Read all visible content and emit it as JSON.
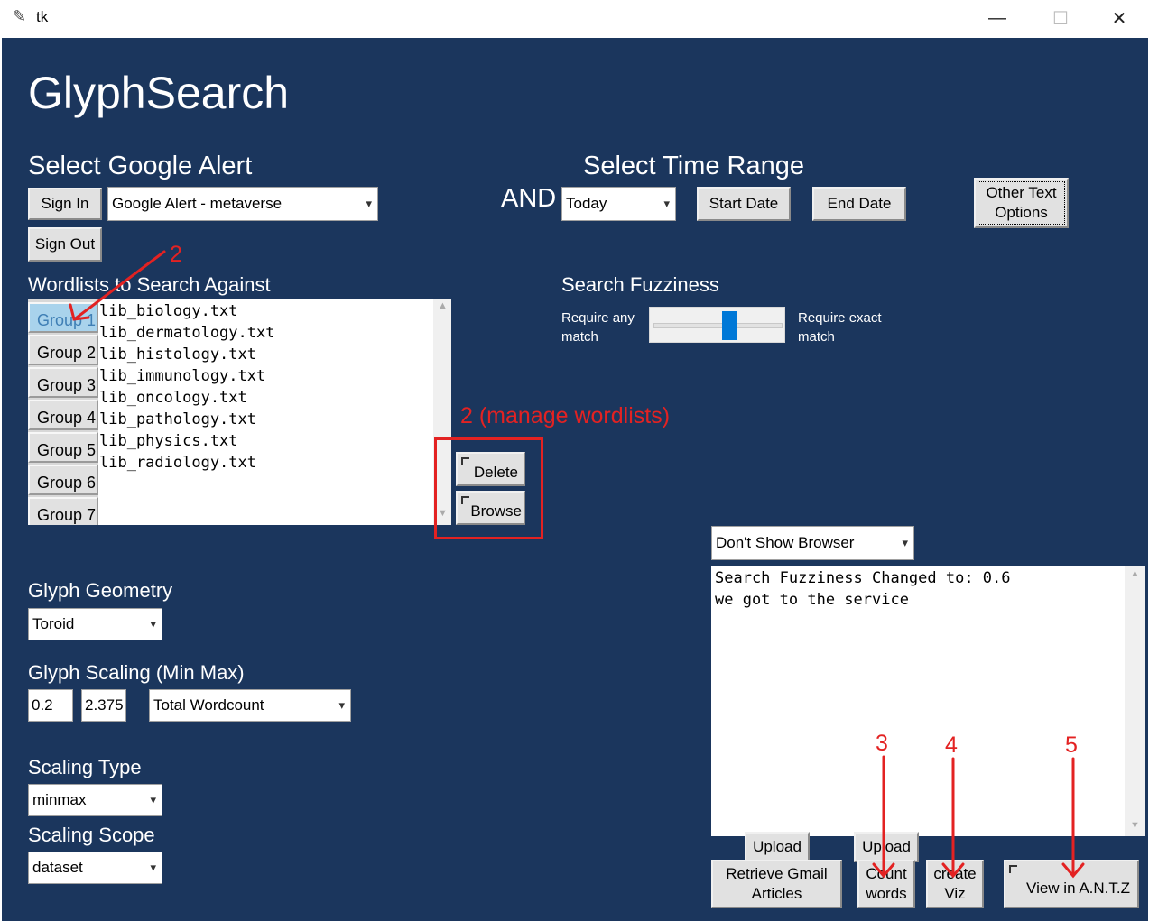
{
  "window": {
    "title": "tk",
    "minimize": "—",
    "maximize": "☐",
    "close": "✕"
  },
  "app_title": "GlyphSearch",
  "google_alert": {
    "heading": "Select Google Alert",
    "sign_in": "Sign In",
    "sign_out": "Sign Out",
    "alert_value": "Google Alert - metaverse"
  },
  "and_label": "AND",
  "time_range": {
    "heading": "Select Time Range",
    "range_value": "Today",
    "start_date": "Start Date",
    "end_date": "End Date"
  },
  "other_text_options": "Other Text Options",
  "wordlists": {
    "heading": "Wordlists to Search Against",
    "groups": [
      "Group 1",
      "Group 2",
      "Group 3",
      "Group 4",
      "Group 5",
      "Group 6",
      "Group 7"
    ],
    "files": [
      "lib_biology.txt",
      "lib_dermatology.txt",
      "lib_histology.txt",
      "lib_immunology.txt",
      "lib_oncology.txt",
      "lib_pathology.txt",
      "lib_physics.txt",
      "lib_radiology.txt"
    ],
    "delete": "Delete",
    "browse": "Browse"
  },
  "fuzziness": {
    "heading": "Search Fuzziness",
    "left_label": "Require any match",
    "right_label": "Require exact match",
    "value": 0.6
  },
  "glyph_geometry": {
    "heading": "Glyph Geometry",
    "value": "Toroid"
  },
  "glyph_scaling": {
    "heading": "Glyph Scaling (Min Max)",
    "min": "0.2",
    "max": "2.375",
    "measure": "Total Wordcount"
  },
  "scaling_type": {
    "heading": "Scaling Type",
    "value": "minmax"
  },
  "scaling_scope": {
    "heading": "Scaling Scope",
    "value": "dataset"
  },
  "browser_option": "Don't Show Browser",
  "log": {
    "lines": [
      "Search Fuzziness Changed to: 0.6",
      "we got to the service"
    ]
  },
  "bottom_buttons": {
    "upload1": "Upload",
    "retrieve": "Retrieve Gmail Articles",
    "upload2": "Upload",
    "count_words": "Count words",
    "create_viz": "create Viz",
    "view_antz": "View in A.N.T.Z"
  },
  "annotations": {
    "a2": "2",
    "a2_manage": "2 (manage wordlists)",
    "a3": "3",
    "a4": "4",
    "a5": "5",
    "color": "#e32222"
  }
}
